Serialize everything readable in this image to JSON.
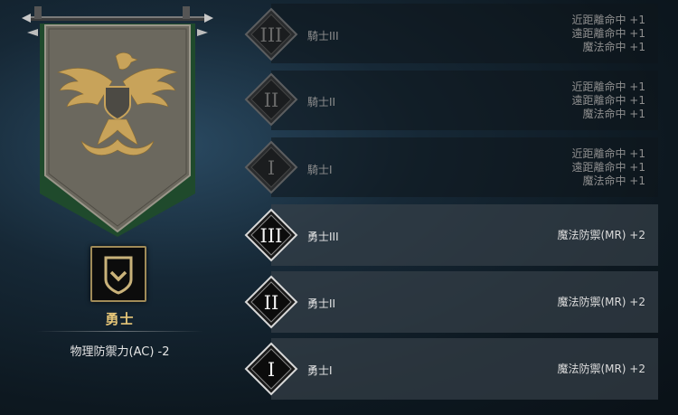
{
  "rank": {
    "name": "勇士",
    "bonus": "物理防禦力(AC) -2"
  },
  "tiers": [
    {
      "numeral": "III",
      "name": "騎士III",
      "active": false,
      "stats": [
        "近距離命中 +1",
        "遠距離命中 +1",
        "魔法命中 +1"
      ]
    },
    {
      "numeral": "II",
      "name": "騎士II",
      "active": false,
      "stats": [
        "近距離命中 +1",
        "遠距離命中 +1",
        "魔法命中 +1"
      ]
    },
    {
      "numeral": "I",
      "name": "騎士I",
      "active": false,
      "stats": [
        "近距離命中 +1",
        "遠距離命中 +1",
        "魔法命中 +1"
      ]
    },
    {
      "numeral": "III",
      "name": "勇士III",
      "active": true,
      "stats": [
        "魔法防禦(MR) +2"
      ]
    },
    {
      "numeral": "II",
      "name": "勇士II",
      "active": true,
      "stats": [
        "魔法防禦(MR) +2"
      ]
    },
    {
      "numeral": "I",
      "name": "勇士I",
      "active": true,
      "stats": [
        "魔法防禦(MR) +2"
      ]
    }
  ],
  "colors": {
    "gold": "#e6c678",
    "banner_cloth": "#6b685e",
    "banner_border": "#1f4a2c",
    "active_row": "#3a4249",
    "inactive_row": "#121b22"
  },
  "icons": {
    "banner": "eagle-crest-icon",
    "badge": "chevron-shield-icon"
  }
}
